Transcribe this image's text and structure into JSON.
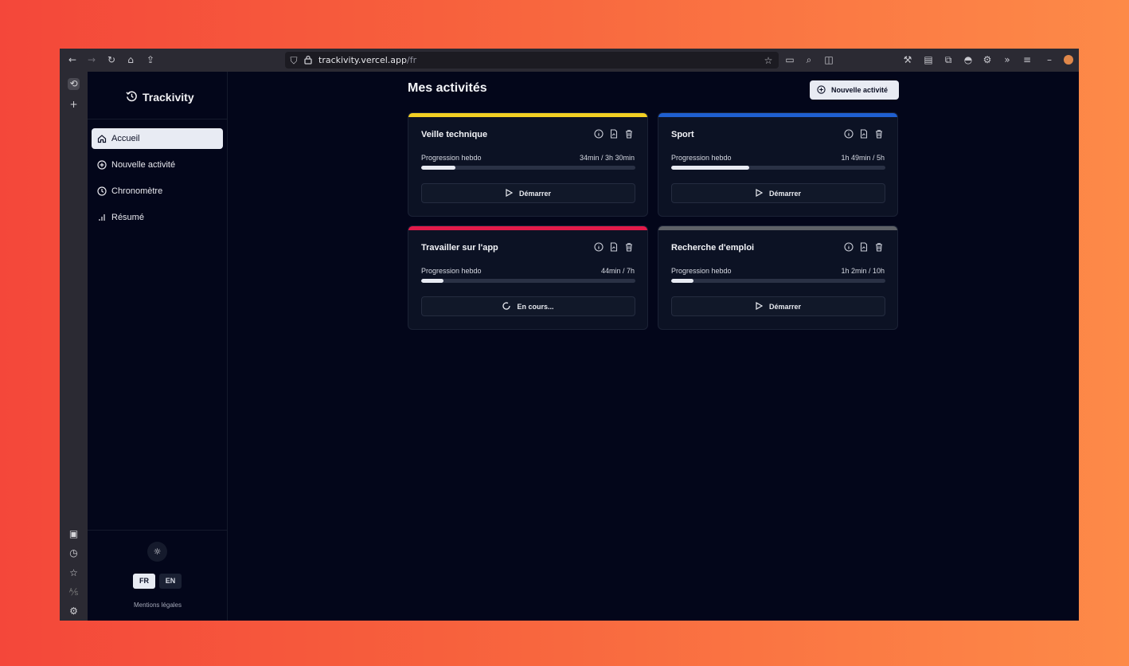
{
  "browser": {
    "url_host": "trackivity.vercel.app",
    "url_path": "/fr"
  },
  "sidebar": {
    "brand": "Trackivity",
    "items": [
      {
        "label": "Accueil",
        "icon": "home-icon",
        "active": true
      },
      {
        "label": "Nouvelle activité",
        "icon": "plus-circle-icon",
        "active": false
      },
      {
        "label": "Chronomètre",
        "icon": "clock-icon",
        "active": false
      },
      {
        "label": "Résumé",
        "icon": "bar-chart-icon",
        "active": false
      }
    ],
    "lang_fr": "FR",
    "lang_en": "EN",
    "legal": "Mentions légales"
  },
  "main": {
    "title": "Mes activités",
    "new_button": "Nouvelle activité",
    "cards": [
      {
        "title": "Veille technique",
        "color": "#f2cf23",
        "progress_label": "Progression hebdo",
        "progress_value": "34min  /  3h 30min",
        "progress_fraction": 0.16,
        "button_label": "Démarrer",
        "button_icon": "play-icon"
      },
      {
        "title": "Sport",
        "color": "#1f5fd0",
        "progress_label": "Progression hebdo",
        "progress_value": "1h 49min  /  5h",
        "progress_fraction": 0.365,
        "button_label": "Démarrer",
        "button_icon": "play-icon"
      },
      {
        "title": "Travailler sur l'app",
        "color": "#e31a4a",
        "progress_label": "Progression hebdo",
        "progress_value": "44min  /  7h",
        "progress_fraction": 0.105,
        "button_label": "En cours...",
        "button_icon": "spinner-icon"
      },
      {
        "title": "Recherche d'emploi",
        "color": "#5e6167",
        "progress_label": "Progression hebdo",
        "progress_value": "1h 2min  /  10h",
        "progress_fraction": 0.103,
        "button_label": "Démarrer",
        "button_icon": "play-icon"
      }
    ]
  }
}
